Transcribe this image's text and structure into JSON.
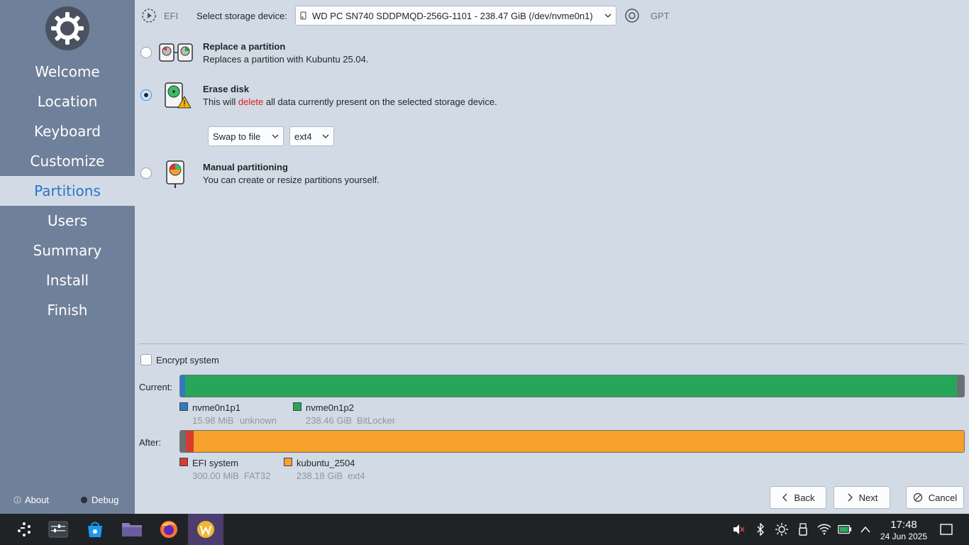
{
  "sidebar": {
    "items": [
      {
        "label": "Welcome"
      },
      {
        "label": "Location"
      },
      {
        "label": "Keyboard"
      },
      {
        "label": "Customize"
      },
      {
        "label": "Partitions"
      },
      {
        "label": "Users"
      },
      {
        "label": "Summary"
      },
      {
        "label": "Install"
      },
      {
        "label": "Finish"
      }
    ],
    "about_label": "About",
    "debug_label": "Debug"
  },
  "top": {
    "efi_label": "EFI",
    "storage_label": "Select storage device:",
    "storage_value": "WD PC SN740 SDDPMQD-256G-1101 - 238.47 GiB (/dev/nvme0n1)",
    "table_type": "GPT"
  },
  "options": {
    "replace": {
      "title": "Replace a partition",
      "desc": "Replaces a partition with Kubuntu 25.04."
    },
    "erase": {
      "title": "Erase disk",
      "desc_pre": "This will ",
      "desc_del": "delete",
      "desc_post": " all data currently present on the selected storage device."
    },
    "manual": {
      "title": "Manual partitioning",
      "desc": "You can create or resize partitions yourself."
    },
    "swap_value": "Swap to file",
    "fs_value": "ext4"
  },
  "encrypt_label": "Encrypt system",
  "current": {
    "label": "Current:",
    "partitions": [
      {
        "name": "nvme0n1p1",
        "size": "15.98 MiB",
        "fs": "unknown",
        "color": "#2f7bc4"
      },
      {
        "name": "nvme0n1p2",
        "size": "238.46 GiB",
        "fs": "BitLocker",
        "color": "#27a65a"
      }
    ]
  },
  "after": {
    "label": "After:",
    "partitions": [
      {
        "name": "EFI system",
        "size": "300.00 MiB",
        "fs": "FAT32",
        "color": "#d63c2f"
      },
      {
        "name": "kubuntu_2504",
        "size": "238.18 GiB",
        "fs": "ext4",
        "color": "#f5a12c"
      }
    ]
  },
  "buttons": {
    "back": "Back",
    "next": "Next",
    "cancel": "Cancel"
  },
  "clock": {
    "time": "17:48",
    "date": "24 Jun 2025"
  }
}
